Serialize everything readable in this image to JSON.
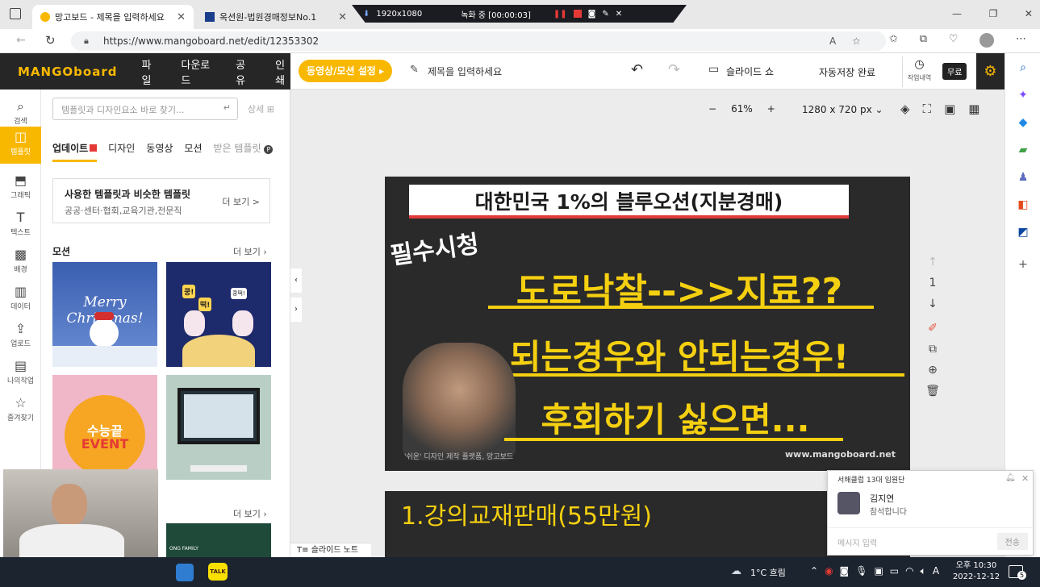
{
  "browser": {
    "tabs": [
      {
        "title": "망고보드 - 제목을 입력하세요"
      },
      {
        "title": "옥션원-법원경매정보No.1"
      }
    ],
    "recorder": {
      "resolution": "1920x1080",
      "status": "녹화 중 [00:00:03]"
    },
    "url": "https://www.mangoboard.net/edit/12353302"
  },
  "app": {
    "logo": "MANGOboard",
    "menus": [
      "파일",
      "다운로드",
      "공유",
      "인쇄"
    ],
    "motion_button": "동영상/모션 설정 ▸",
    "title_placeholder": "제목을 입력하세요",
    "slideshow": "슬라이드 쇼",
    "autosave": "자동저장 완료",
    "history": "작업내역",
    "plan": "무료",
    "zoom": "61%",
    "size": "1280 x 720 px",
    "page_number": "1",
    "slide_note": "슬라이드 노트"
  },
  "rail": [
    "검색",
    "템플릿",
    "그래픽",
    "텍스트",
    "배경",
    "데이터",
    "업로드",
    "나의작업",
    "즐겨찾기"
  ],
  "panel": {
    "search_placeholder": "템플릿과 디자인요소 바로 찾기...",
    "detail": "상세",
    "tabs": [
      "업데이트",
      "디자인",
      "동영상",
      "모션",
      "받은 템플릿"
    ],
    "similar_title": "사용한 템플릿과 비슷한 템플릿",
    "similar_sub": "공공·센터·협회,교육기관,전문직",
    "more": "더 보기 >",
    "section_motion": "모션",
    "section_more": "더 보기",
    "thumb1": "Merry Christmas!",
    "thumb2a": "쿵!",
    "thumb2b": "떡!",
    "thumb2c": "쿵떡!",
    "thumb3a": "수능끝",
    "thumb3b": "EVENT",
    "thumb4": "ONG FAMILY"
  },
  "slide": {
    "top_title": "대한민국 1%의 블루오션(지분경매)",
    "tag": "필수시청",
    "line1": "도로낙찰-->>지료??",
    "line2": "되는경우와 안되는경우!",
    "line3": "후회하기 싫으면...",
    "credit": "'쉬운' 디자인 제작 플랫폼, 망고보드",
    "watermark": "www.mangoboard.net"
  },
  "slide2": {
    "line1": "1.강의교재판매(55만원)"
  },
  "chat": {
    "group": "서해클럽 13대 임원단",
    "name": "김지연",
    "message": "참석합니다",
    "input_placeholder": "메시지 입력",
    "send": "전송"
  },
  "taskbar": {
    "weather": "1°C 흐림",
    "ime": "A",
    "ampm": "오후 10:30",
    "date": "2022-12-12",
    "notif": "5",
    "kakao": "TALK"
  },
  "colors": {
    "accent": "#f9b800",
    "slide_bg": "#2a2a2a",
    "highlight": "#f5d010"
  }
}
